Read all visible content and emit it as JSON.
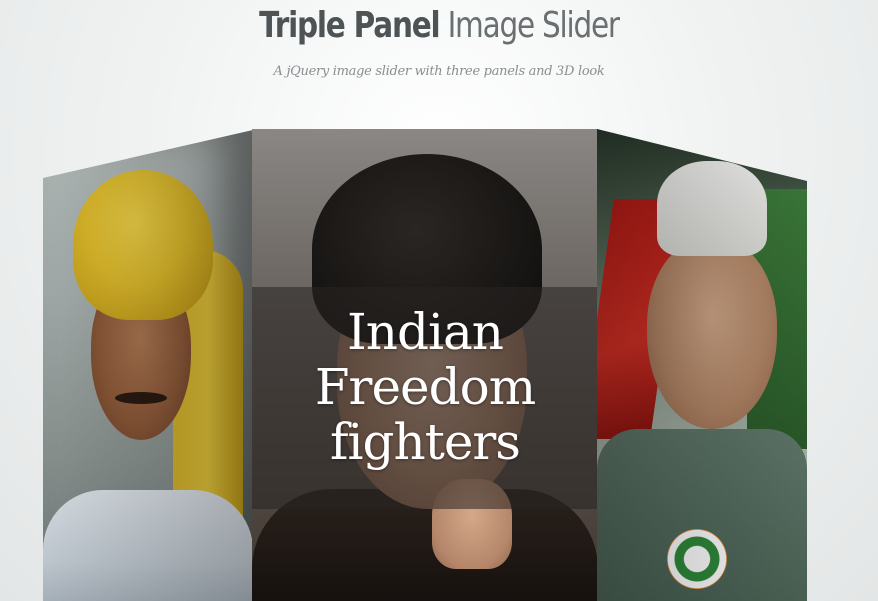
{
  "header": {
    "title_bold": "Triple Panel",
    "title_light": "Image Slider",
    "subtitle": "A jQuery image slider with three panels and 3D look"
  },
  "slider": {
    "caption": "Indian Freedom fighters",
    "caption_lines": [
      "Indian",
      "Freedom",
      "fighters"
    ],
    "panels": [
      {
        "position": "left",
        "subject": "turbaned-man-portrait"
      },
      {
        "position": "center",
        "subject": "man-with-hand-on-chin-portrait"
      },
      {
        "position": "right",
        "subject": "man-in-white-cap-portrait"
      }
    ]
  },
  "colors": {
    "title_text": "#4e5355",
    "subtitle_text": "#8a8e90",
    "background": "#f1f3f3",
    "caption_text": "#ffffff"
  }
}
